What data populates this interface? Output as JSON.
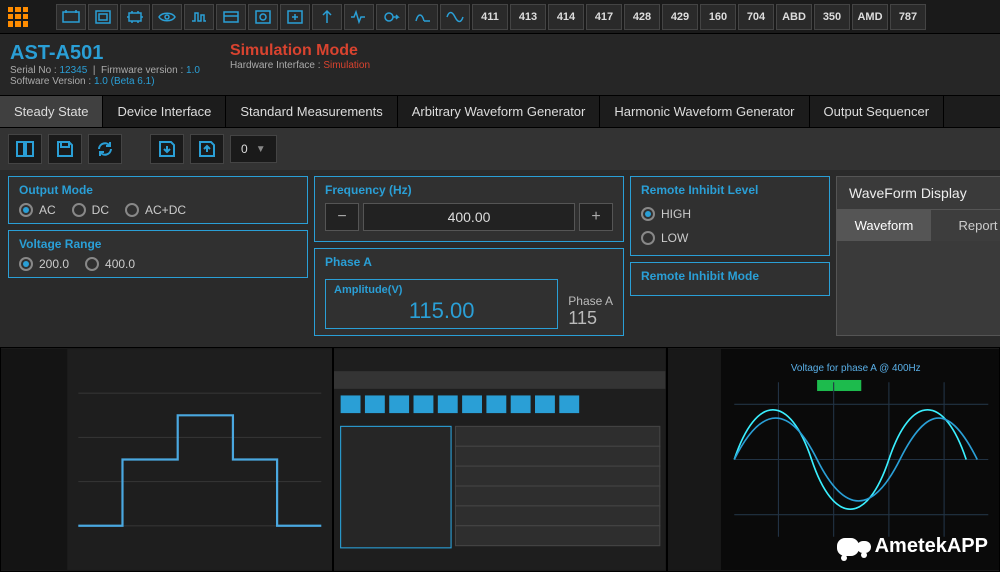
{
  "topbar": {
    "num_buttons": [
      "411",
      "413",
      "414",
      "417",
      "428",
      "429",
      "160",
      "704",
      "ABD",
      "350",
      "AMD",
      "787"
    ]
  },
  "device": {
    "title": "AST-A501",
    "serial_label": "Serial No :",
    "serial": "12345",
    "fw_label": "Firmware version :",
    "fw": "1.0",
    "sw_label": "Software Version :",
    "sw": "1.0 (Beta 6.1)"
  },
  "sim": {
    "title": "Simulation Mode",
    "hw_label": "Hardware Interface :",
    "hw": "Simulation"
  },
  "tabs": [
    "Steady State",
    "Device Interface",
    "Standard Measurements",
    "Arbitrary Waveform Generator",
    "Harmonic Waveform Generator",
    "Output Sequencer"
  ],
  "slot": "0",
  "panels": {
    "output_mode": {
      "title": "Output Mode",
      "options": [
        "AC",
        "DC",
        "AC+DC"
      ],
      "selected": 0
    },
    "voltage_range": {
      "title": "Voltage Range",
      "options": [
        "200.0",
        "400.0"
      ],
      "selected": 0
    },
    "frequency": {
      "title": "Frequency (Hz)",
      "value": "400.00"
    },
    "phase_a": {
      "title": "Phase A",
      "amp_title": "Amplitude(V)",
      "amp_value": "115.00",
      "side_label": "Phase A",
      "side_value": "115"
    },
    "remote_inhibit_level": {
      "title": "Remote Inhibit Level",
      "options": [
        "HIGH",
        "LOW"
      ],
      "selected": 0
    },
    "remote_inhibit_mode": {
      "title": "Remote Inhibit Mode"
    },
    "waveform_display": {
      "title": "WaveForm Display",
      "tabs": [
        "Waveform",
        "Report"
      ],
      "active": 0
    }
  },
  "thumb_center": {
    "chart_title": "Voltage for phase A @ 400Hz"
  },
  "watermark": "AmetekAPP"
}
